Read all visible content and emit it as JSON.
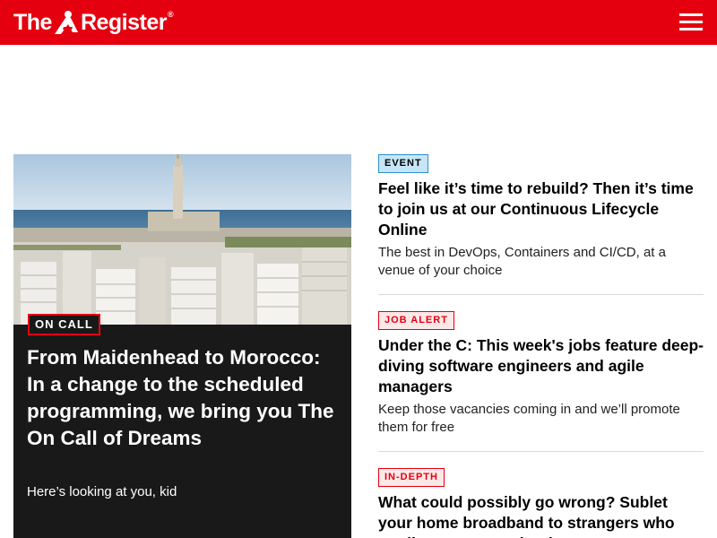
{
  "header": {
    "logo_text_left": "The",
    "logo_text_right": "Register",
    "logo_mark": "®",
    "menu_icon": "hamburger-menu-icon"
  },
  "colors": {
    "brand_red": "#e4000f",
    "feature_bg": "#191919",
    "event_tag_bg": "#c6e6f7",
    "event_tag_border": "#2d8fcf",
    "alert_tag_bg": "#fde8e8"
  },
  "feature": {
    "image_alt": "Casablanca skyline with Hassan II Mosque minaret",
    "kicker": "ON CALL",
    "title": "From Maidenhead to Morocco: In a change to the scheduled programming, we bring you The On Call of Dreams",
    "standfirst": "Here’s looking at you, kid"
  },
  "stories": [
    {
      "kicker": "EVENT",
      "title": "Feel like it’s time to rebuild? Then it’s time to join us at our Continuous Lifecycle Online",
      "standfirst": "The best in DevOps, Containers and CI/CD, at a venue of your choice"
    },
    {
      "kicker": "JOB ALERT",
      "title": "Under the C: This week's jobs feature deep-diving software engineers and agile managers",
      "standfirst": "Keep those vacancies coming in and we’ll promote them for free"
    },
    {
      "kicker": "IN-DEPTH",
      "title": "What could possibly go wrong? Sublet your home broadband to strangers who totally won't commit crimes",
      "standfirst": ""
    }
  ]
}
